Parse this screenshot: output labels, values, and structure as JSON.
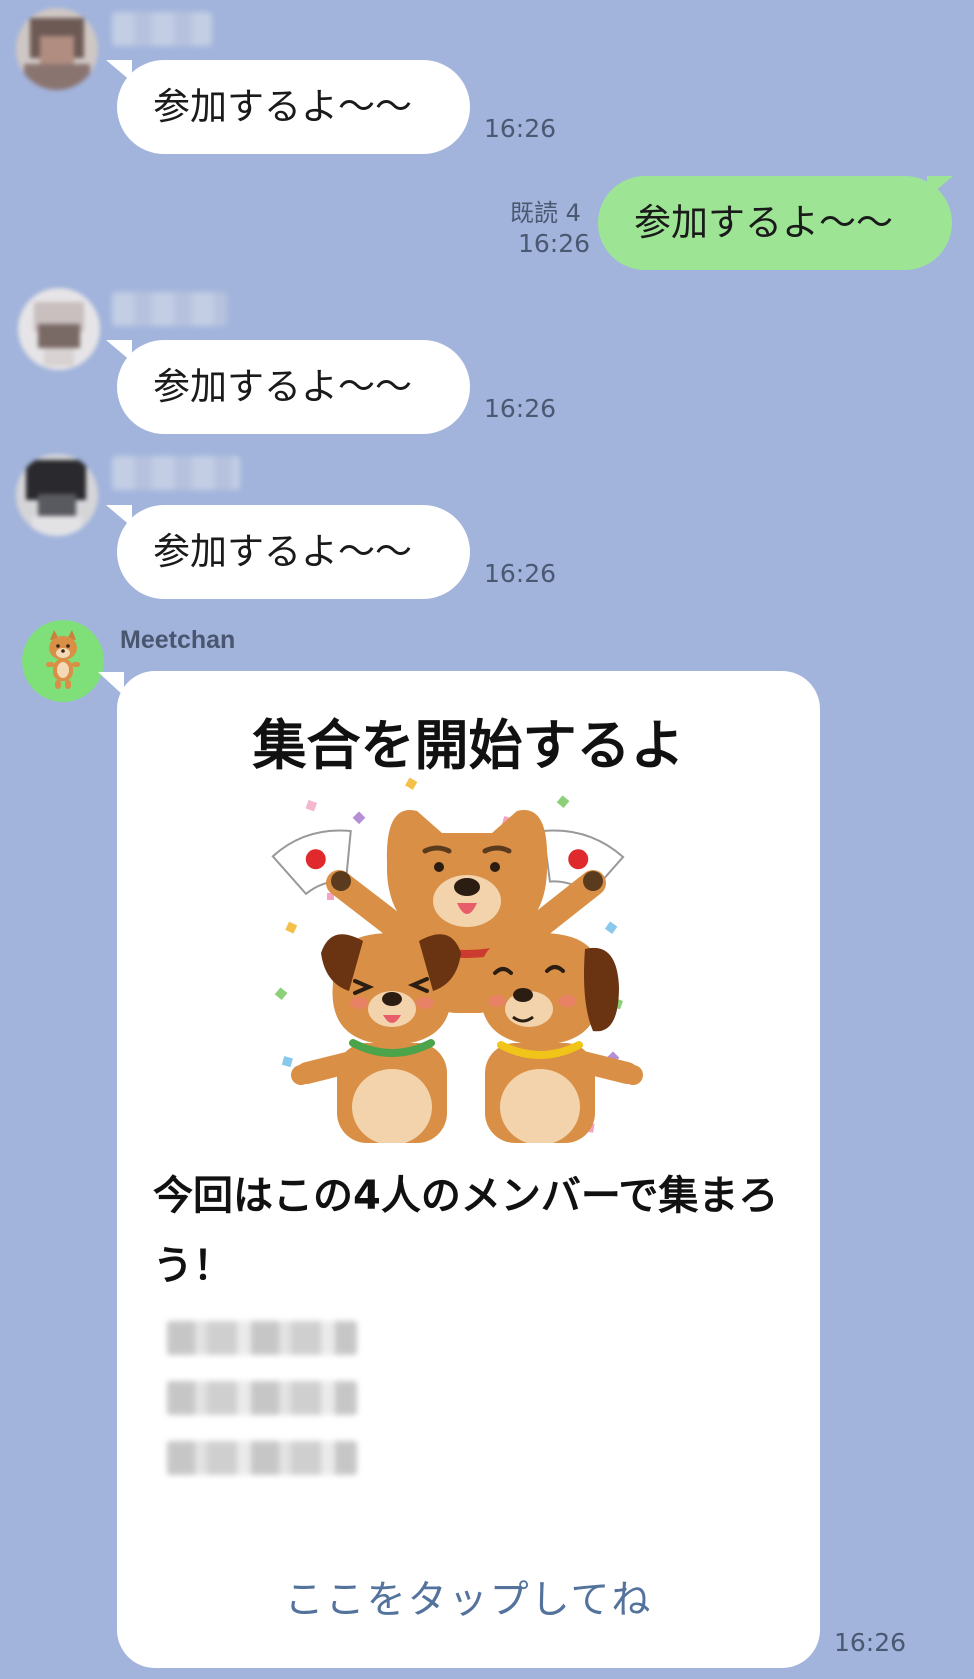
{
  "messages": [
    {
      "type": "incoming",
      "text": "参加するよ〜〜",
      "time": "16:26"
    },
    {
      "type": "outgoing",
      "text": "参加するよ〜〜",
      "read": "既読 4",
      "time": "16:26"
    },
    {
      "type": "incoming",
      "text": "参加するよ〜〜",
      "time": "16:26"
    },
    {
      "type": "incoming",
      "text": "参加するよ〜〜",
      "time": "16:26"
    }
  ],
  "bot": {
    "name": "Meetchan",
    "card": {
      "title": "集合を開始するよ",
      "body": "今回はこの4人のメンバーで集まろう！",
      "link": "ここをタップしてね",
      "time": "16:26"
    }
  },
  "colors": {
    "background": "#a2b4dc",
    "incoming_bubble": "#ffffff",
    "outgoing_bubble": "#9de495",
    "link": "#54739c",
    "bot_avatar": "#7fe07a"
  }
}
